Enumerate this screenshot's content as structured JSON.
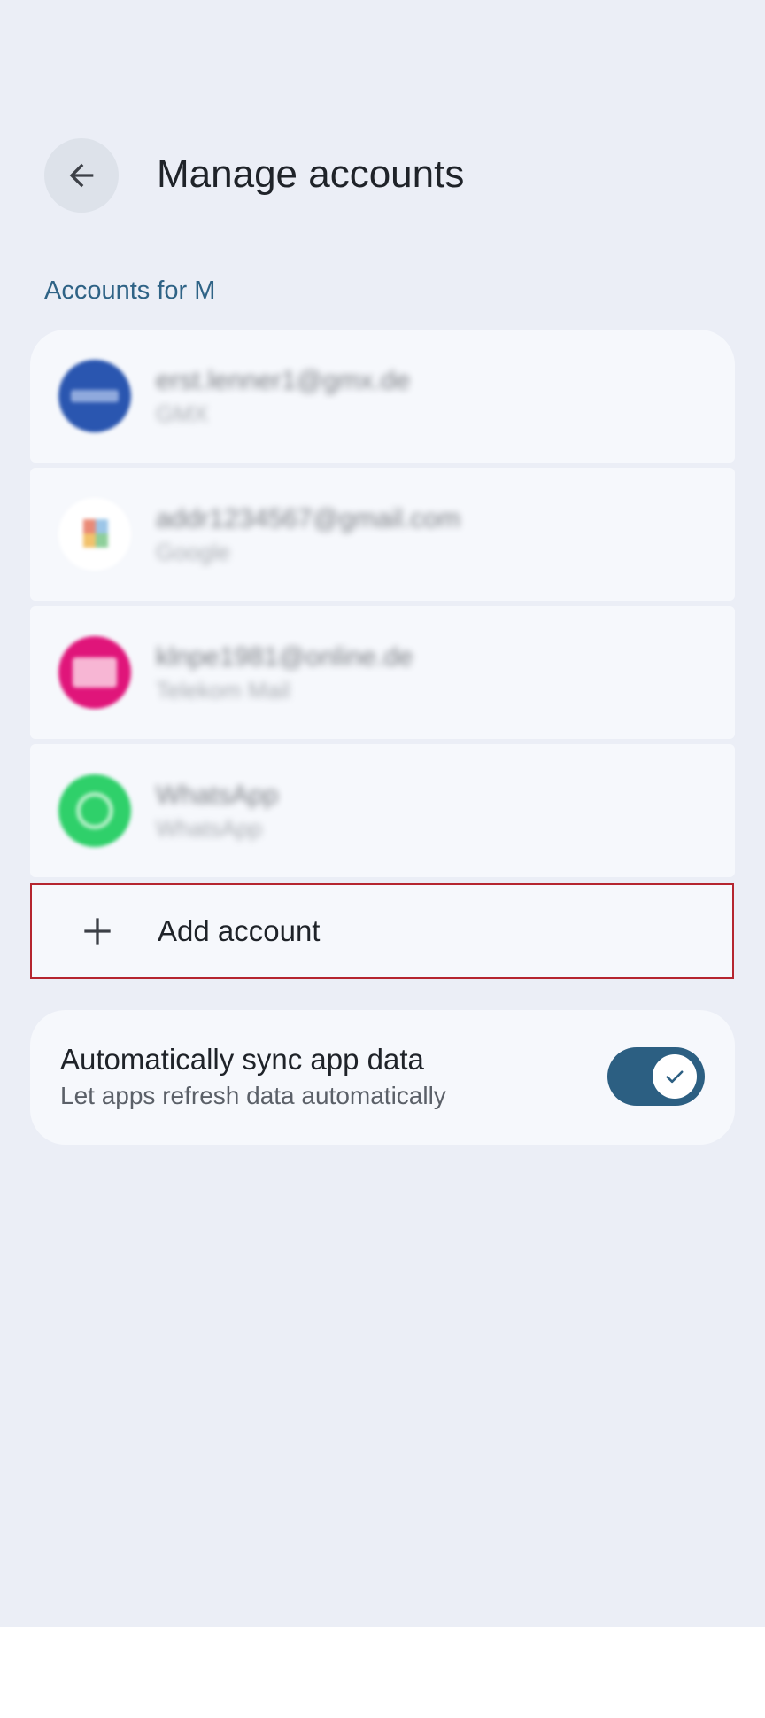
{
  "header": {
    "title": "Manage accounts",
    "back_icon": "arrow-back-icon"
  },
  "section": {
    "label": "Accounts for M"
  },
  "accounts": [
    {
      "line1": "erst.lenner1@gmx.de",
      "line2": "GMX",
      "avatar_color": "#2a56b0",
      "icon": "gmx-icon"
    },
    {
      "line1": "addr1234567@gmail.com",
      "line2": "Google",
      "avatar_color": "#ffffff",
      "icon": "google-icon"
    },
    {
      "line1": "klnpe1981@online.de",
      "line2": "Telekom Mail",
      "avatar_color": "#e0157a",
      "icon": "mail-icon"
    },
    {
      "line1": "WhatsApp",
      "line2": "WhatsApp",
      "avatar_color": "#2fd06a",
      "icon": "whatsapp-icon"
    }
  ],
  "add_account": {
    "label": "Add account",
    "icon": "plus-icon"
  },
  "sync": {
    "title": "Automatically sync app data",
    "subtitle": "Let apps refresh data automatically",
    "enabled": true,
    "toggle_color": "#2c5f82"
  }
}
